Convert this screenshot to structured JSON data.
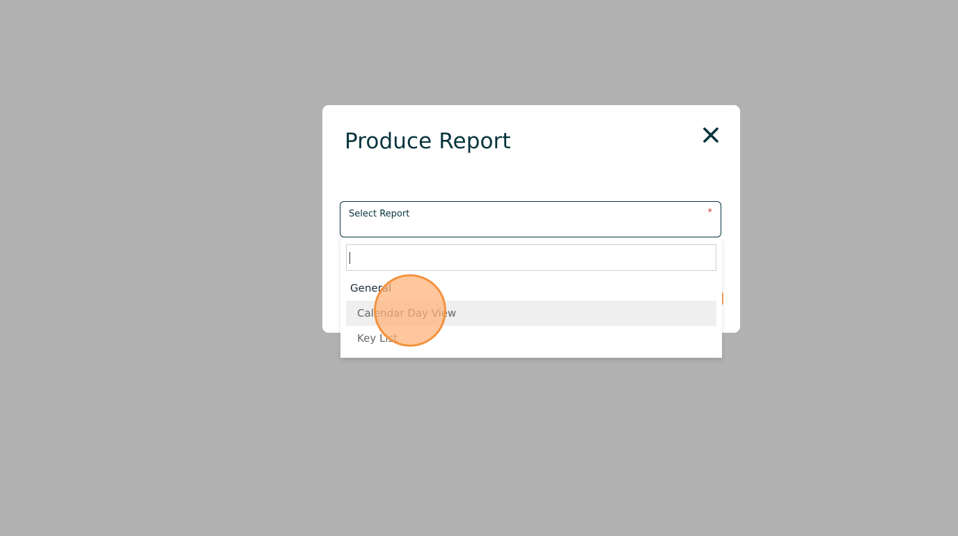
{
  "modal": {
    "title": "Produce Report",
    "close_icon": "close-icon"
  },
  "select_report": {
    "label": "Select Report",
    "required_marker": "*"
  },
  "dropdown": {
    "search_value": "",
    "group_label": "General",
    "options": [
      {
        "label": "Calendar Day View",
        "highlighted": true
      },
      {
        "label": "Key List",
        "highlighted": false
      }
    ]
  },
  "colors": {
    "backdrop": "#b1b1b1",
    "primary_text": "#06343d",
    "required": "#c0392b",
    "highlight_row": "#efefef",
    "click_indicator": "#f4923e"
  }
}
